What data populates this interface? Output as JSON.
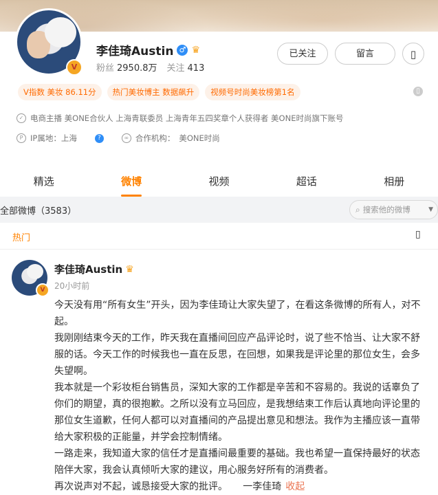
{
  "profile": {
    "name": "李佳琦Austin",
    "fans_label": "粉丝",
    "fans_count": "2950.8万",
    "follow_label": "关注",
    "follow_count": "413",
    "gender_symbol": "♂"
  },
  "actions": {
    "followed_label": "已关注",
    "message_label": "留言",
    "more_icon": "▯"
  },
  "tags": [
    "V指数 美妆 86.11分",
    "热门美妆博主 数据飙升",
    "视频号时尚美妆榜第1名"
  ],
  "tags_more_icon": "▯",
  "info": {
    "description": "电商主播 美ONE合伙人 上海青联委员 上海青年五四奖章个人获得者 美ONE时尚旗下账号",
    "ip_label": "IP属地：上海",
    "org_label": "合作机构：",
    "org_value": "美ONE时尚"
  },
  "tabs": [
    {
      "label": "精选"
    },
    {
      "label": "微博"
    },
    {
      "label": "视频"
    },
    {
      "label": "超话"
    },
    {
      "label": "相册"
    }
  ],
  "filter": {
    "count_label": "全部微博（3583）",
    "search_placeholder": "搜索他的微博"
  },
  "section": {
    "hot_label": "热门",
    "menu_icon": "▯"
  },
  "post": {
    "author": "李佳琦Austin",
    "time": "20小时前",
    "paragraphs": [
      "今天没有用“所有女生”开头，因为李佳琦让大家失望了，在看这条微博的所有人，对不起。",
      "我刚刚结束今天的工作，昨天我在直播间回应产品评论时，说了些不恰当、让大家不舒服的话。今天工作的时候我也一直在反思，在回想，如果我是评论里的那位女生，会多失望啊。",
      "我本就是一个彩妆柜台销售员，深知大家的工作都是辛苦和不容易的。我说的话辜负了你们的期望，真的很抱歉。之所以没有立马回应，是我想结束工作后认真地向评论里的那位女生道歉，任何人都可以对直播间的产品提出意见和想法。我作为主播应该一直带给大家积极的正能量，并学会控制情绪。",
      "一路走来，我知道大家的信任才是直播间最重要的基础。我也希望一直保持最好的状态陪伴大家，我会认真倾听大家的建议，用心服务好所有的消费者。"
    ],
    "last_line": "再次说声对不起，诚恳接受大家的批评。     一李佳琦",
    "collapse_label": "收起"
  },
  "colors": {
    "accent": "#ff8200",
    "tag_bg": "#fdf1e8",
    "tag_text": "#ff6a00",
    "link": "#eb7350"
  }
}
